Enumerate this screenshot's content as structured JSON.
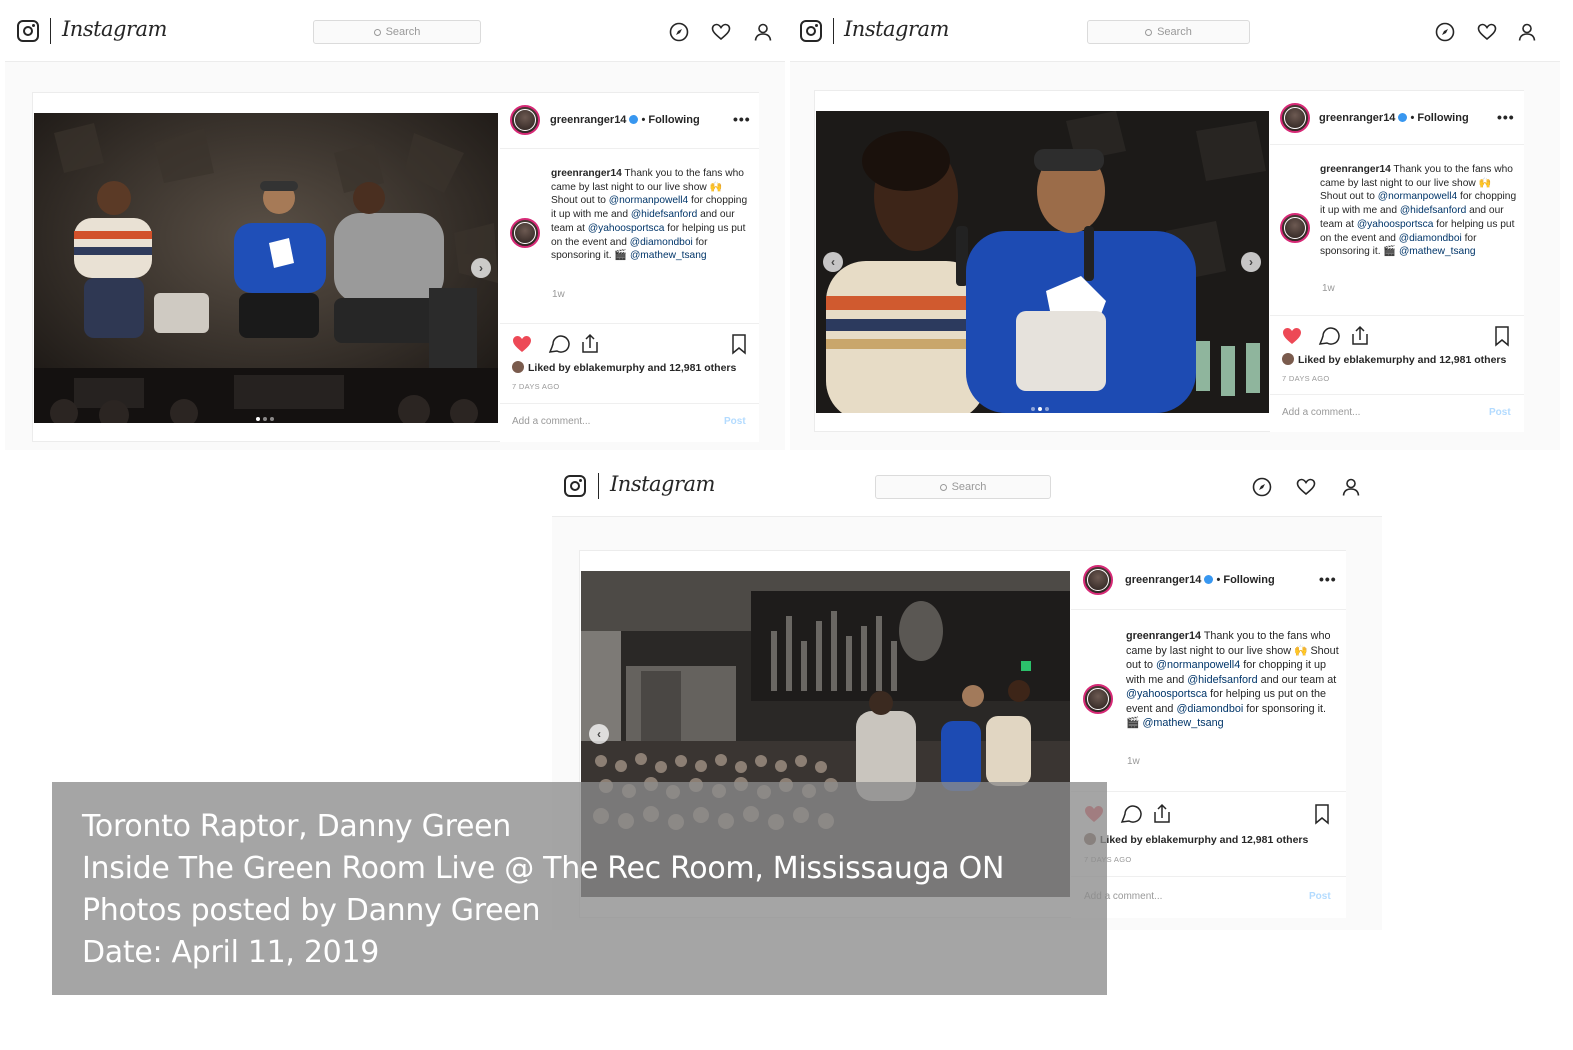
{
  "app": {
    "wordmark": "Instagram",
    "search_placeholder": "Search",
    "brand_colors": {
      "like": "#ed4956",
      "verified": "#3897f0",
      "mention": "#003569",
      "post_disabled": "#b3dbff"
    }
  },
  "post": {
    "username": "greenranger14",
    "follow_status": "• Following",
    "more": "•••",
    "caption_user": "greenranger14",
    "caption_parts": [
      {
        "t": " Thank you to the fans who came by last night to our live show 🙌 Shout out to ",
        "m": false
      },
      {
        "t": "@normanpowell4",
        "m": true
      },
      {
        "t": " for chopping it up with me and ",
        "m": false
      },
      {
        "t": "@hidefsanford",
        "m": true
      },
      {
        "t": " and our team at ",
        "m": false
      },
      {
        "t": "@yahoosportsca",
        "m": true
      },
      {
        "t": " for helping us put on the event and ",
        "m": false
      },
      {
        "t": "@diamondboi",
        "m": true
      },
      {
        "t": " for sponsoring it. 🎬 ",
        "m": false
      },
      {
        "t": "@mathew_tsang",
        "m": true
      }
    ],
    "age": "1w",
    "liked_by": "Liked by eblakemurphy and 12,981 others",
    "days_ago": "7 DAYS AGO",
    "comment_placeholder": "Add a comment...",
    "post_label": "Post"
  },
  "overlay": {
    "line1": "Toronto Raptor, Danny Green",
    "line2": "Inside The Green Room Live @ The Rec Room, Mississauga ON",
    "line3": "Photos posted by Danny Green",
    "line4": "Date: April 11, 2019"
  }
}
